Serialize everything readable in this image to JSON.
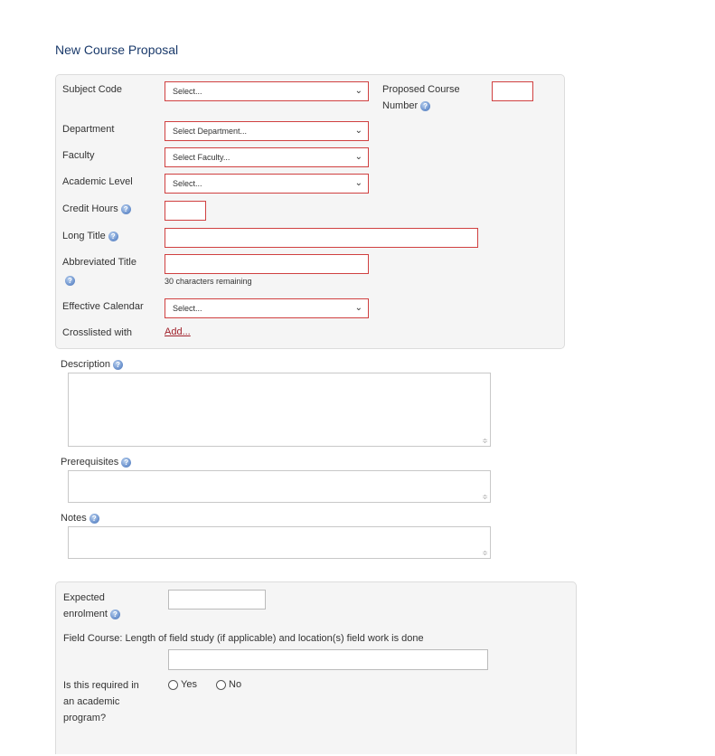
{
  "page_title": "New Course Proposal",
  "course_info": {
    "subject_code_label": "Subject Code",
    "subject_code_value": "Select...",
    "proposed_number_label_line1": "Proposed Course",
    "proposed_number_label_line2": "Number",
    "department_label": "Department",
    "department_value": "Select Department...",
    "faculty_label": "Faculty",
    "faculty_value": "Select Faculty...",
    "academic_level_label": "Academic Level",
    "academic_level_value": "Select...",
    "credit_hours_label": "Credit Hours",
    "long_title_label": "Long Title",
    "abbreviated_title_label": "Abbreviated Title",
    "chars_remaining": "30 characters remaining",
    "effective_calendar_label": "Effective Calendar",
    "effective_calendar_value": "Select...",
    "crosslisted_label": "Crosslisted with",
    "crosslisted_link": "Add..."
  },
  "text_areas": {
    "description_label": "Description",
    "prerequisites_label": "Prerequisites",
    "notes_label": "Notes"
  },
  "enrolment": {
    "expected_label_line1": "Expected",
    "expected_label_line2": "enrolment",
    "field_course_label": "Field Course: Length of field study (if applicable) and location(s) field work is done",
    "required_label_line1": "Is this required in",
    "required_label_line2": "an academic",
    "required_label_line3": "program?",
    "yes_label": "Yes",
    "no_label": "No"
  },
  "icons": {
    "help": "help-icon",
    "dropdown": "chevron-down-icon",
    "resize": "resize-handle-icon"
  },
  "colors": {
    "title": "#1a3a6b",
    "required_border": "#d04040",
    "link": "#a0202a",
    "panel_bg": "#f5f5f5"
  }
}
